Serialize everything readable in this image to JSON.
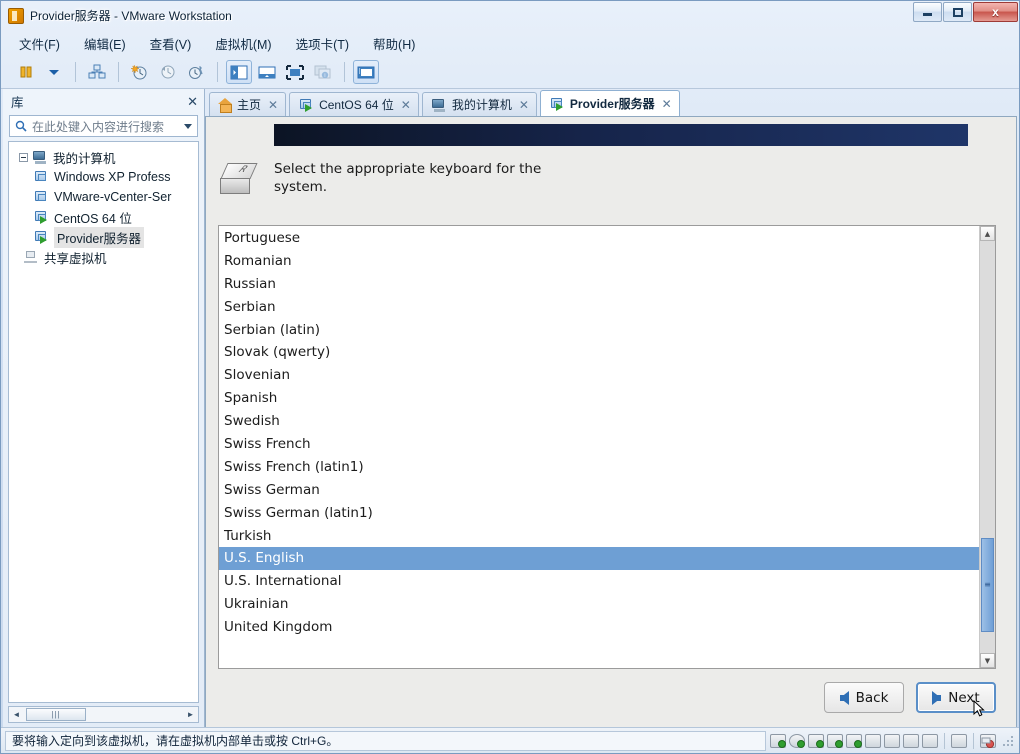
{
  "window": {
    "title": "Provider服务器 - VMware Workstation",
    "icon": "vmware-icon",
    "controls": {
      "minimize": "minimize-icon",
      "maximize": "maximize-icon",
      "close": "x"
    }
  },
  "menubar": {
    "items": [
      {
        "label": "文件(F)",
        "text": "文件",
        "accel": "F"
      },
      {
        "label": "编辑(E)",
        "text": "编辑",
        "accel": "E"
      },
      {
        "label": "查看(V)",
        "text": "查看",
        "accel": "V"
      },
      {
        "label": "虚拟机(M)",
        "text": "虚拟机",
        "accel": "M"
      },
      {
        "label": "选项卡(T)",
        "text": "选项卡",
        "accel": "T"
      },
      {
        "label": "帮助(H)",
        "text": "帮助",
        "accel": "H"
      }
    ]
  },
  "toolbar": {
    "buttons": [
      {
        "name": "power-button",
        "icon": "pause-icon"
      },
      {
        "name": "power-dropdown",
        "icon": "chevron-down-icon"
      },
      {
        "name": "manage-snapshots",
        "icon": "snapshot-manager-icon"
      },
      {
        "name": "take-snapshot",
        "icon": "take-snapshot-icon"
      },
      {
        "name": "revert-snapshot",
        "icon": "revert-snapshot-icon"
      },
      {
        "name": "snapshot-manager",
        "icon": "snapshot-wrench-icon"
      },
      {
        "name": "show-library",
        "icon": "library-panel-icon",
        "pressed": true
      },
      {
        "name": "show-thumbnail-bar",
        "icon": "thumbnail-bar-icon"
      },
      {
        "name": "enter-fullscreen",
        "icon": "fullscreen-icon"
      },
      {
        "name": "unity-mode",
        "icon": "unity-mode-icon",
        "disabled": true
      },
      {
        "name": "console-view",
        "icon": "console-view-icon",
        "pressed": true
      }
    ]
  },
  "sidebar": {
    "title": "库",
    "close_label": "✕",
    "search": {
      "placeholder": "在此处键入内容进行搜索",
      "value": "",
      "icon": "search-icon",
      "dropdown_icon": "chevron-down-icon"
    },
    "tree": [
      {
        "label": "我的计算机",
        "icon": "computer-icon",
        "level": 0,
        "expanded": true,
        "selected": false,
        "running": false
      },
      {
        "label": "Windows XP Profess",
        "icon": "vm-icon",
        "level": 1,
        "selected": false,
        "running": false
      },
      {
        "label": "VMware-vCenter-Ser",
        "icon": "vm-icon",
        "level": 1,
        "selected": false,
        "running": false
      },
      {
        "label": "CentOS 64 位",
        "icon": "vm-icon",
        "level": 1,
        "selected": false,
        "running": true
      },
      {
        "label": "Provider服务器",
        "icon": "vm-icon",
        "level": 1,
        "selected": true,
        "running": true
      },
      {
        "label": "共享虚拟机",
        "icon": "shared-vms-icon",
        "level": 0,
        "selected": false,
        "running": false
      }
    ],
    "hscroll": {
      "left_arrow": "◄",
      "right_arrow": "►",
      "grip": "|||"
    }
  },
  "tabs": [
    {
      "label": "主页",
      "icon": "home-icon",
      "active": false,
      "close": "✕"
    },
    {
      "label": "CentOS 64 位",
      "icon": "vm-icon",
      "active": false,
      "close": "✕",
      "running": true
    },
    {
      "label": "我的计算机",
      "icon": "computer-icon",
      "active": false,
      "close": "✕"
    },
    {
      "label": "Provider服务器",
      "icon": "vm-icon",
      "active": true,
      "close": "✕",
      "running": true
    }
  ],
  "vm_console": {
    "banner_colors": {
      "start": "#0c1424",
      "end": "#1f3568"
    },
    "prompt": {
      "icon": "keyboard-keycap-icon",
      "keycap_letter": "R",
      "text": "Select the appropriate keyboard for the system."
    },
    "keyboard_list": {
      "items": [
        "Portuguese",
        "Romanian",
        "Russian",
        "Serbian",
        "Serbian (latin)",
        "Slovak (qwerty)",
        "Slovenian",
        "Spanish",
        "Swedish",
        "Swiss French",
        "Swiss French (latin1)",
        "Swiss German",
        "Swiss German (latin1)",
        "Turkish",
        "U.S. English",
        "U.S. International",
        "Ukrainian",
        "United Kingdom"
      ],
      "selected": "U.S. English",
      "selection_color": "#6e9fd4",
      "scrollbar": {
        "up_arrow": "▲",
        "down_arrow": "▼",
        "thumb_position_pct": 72,
        "thumb_size_pct": 23
      }
    },
    "buttons": {
      "back": {
        "label": "Back",
        "icon": "arrow-left-icon",
        "focused": false
      },
      "next": {
        "label": "Next",
        "icon": "arrow-right-icon",
        "focused": true
      }
    },
    "cursor": "mouse-pointer"
  },
  "statusbar": {
    "message": "要将输入定向到该虚拟机，请在虚拟机内部单击或按 Ctrl+G。",
    "devices": [
      {
        "name": "hard-disk-icon",
        "connected": true
      },
      {
        "name": "cd-dvd-icon",
        "connected": true,
        "round": true
      },
      {
        "name": "network-adapter-icon",
        "connected": true
      },
      {
        "name": "printer-icon",
        "connected": true
      },
      {
        "name": "sound-card-icon",
        "connected": true
      },
      {
        "name": "usb-controller-icon",
        "connected": false
      },
      {
        "name": "camera-icon",
        "connected": false
      },
      {
        "name": "floppy-icon",
        "connected": false
      },
      {
        "name": "display-icon",
        "connected": false
      }
    ],
    "message_icon": {
      "name": "message-log-icon"
    },
    "alert_icon": {
      "name": "alert-icon"
    },
    "resize_grip": "resize-grip-icon"
  }
}
